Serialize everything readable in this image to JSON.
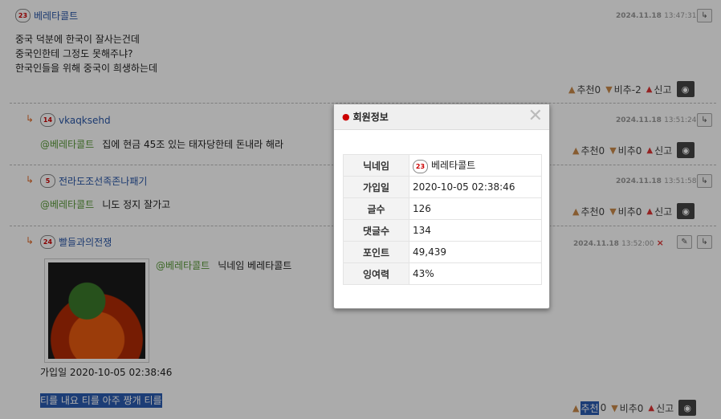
{
  "comments": [
    {
      "author": "베레타콜트",
      "level": "23",
      "date": "2024.11.18",
      "time": "13:47:31",
      "lines": [
        "중국 덕분에 한국이 잘사는건데",
        "중국인한테 그정도 못해주냐?",
        "한국인들을 위해 중국이 희생하는데"
      ],
      "up": "추천0",
      "down": "비추-2",
      "report": "신고"
    },
    {
      "author": "vkaqksehd",
      "level": "14",
      "date": "2024.11.18",
      "time": "13:51:24",
      "mention": "@베레타콜트",
      "text": "집에 현금 45조 있는 태자당한테 돈내라 해라",
      "up": "추천0",
      "down": "비추0",
      "report": "신고"
    },
    {
      "author": "전라도조선족존나패기",
      "level": "5",
      "date": "2024.11.18",
      "time": "13:51:58",
      "mention": "@베레타콜트",
      "text": "니도 정지 잘가고",
      "up": "추천0",
      "down": "비추0",
      "report": "신고"
    },
    {
      "author": "빨들과의전쟁",
      "level": "24",
      "date": "2024.11.18",
      "time": "13:52:00",
      "mention": "@베레타콜트",
      "text": "닉네임 베레타콜트",
      "extra1": "가입일 2020-10-05 02:38:46",
      "extra2": "티를 내요 티를 아주 짱개 티를",
      "up_sel": "추천",
      "up_num": "0",
      "down": "비추0",
      "report": "신고"
    }
  ],
  "popup": {
    "title": "회원정보",
    "close": "✕",
    "rows": [
      {
        "k": "닉네임",
        "v": "베레타콜트",
        "level": "23"
      },
      {
        "k": "가입일",
        "v": "2020-10-05 02:38:46"
      },
      {
        "k": "글수",
        "v": "126"
      },
      {
        "k": "댓글수",
        "v": "134"
      },
      {
        "k": "포인트",
        "v": "49,439"
      },
      {
        "k": "잉여력",
        "v": "43%"
      }
    ]
  },
  "icons": {
    "reply": "↳",
    "eye": "◉",
    "thumb_up": "👍",
    "thumb_down": "👎",
    "warn": "⚠",
    "delete": "×",
    "edit": "✎"
  }
}
